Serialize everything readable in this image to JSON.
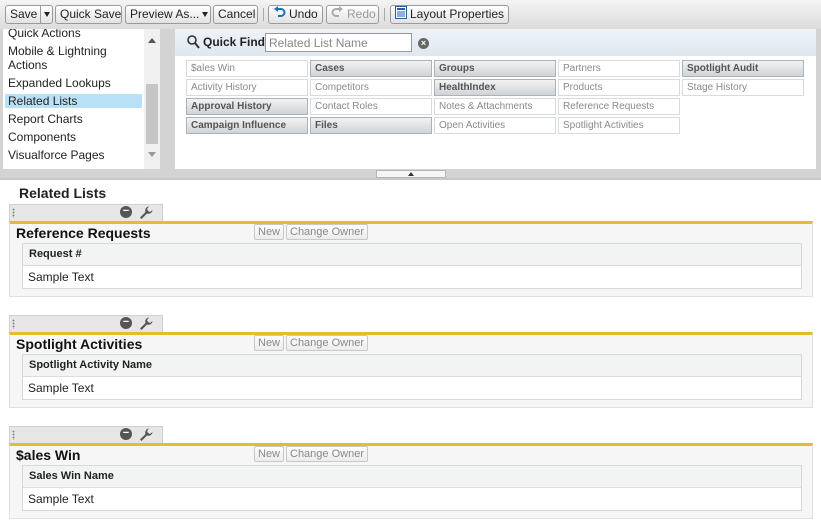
{
  "toolbar": {
    "save": "Save",
    "quick_save": "Quick Save",
    "preview_as": "Preview As...",
    "cancel": "Cancel",
    "undo": "Undo",
    "redo": "Redo",
    "layout_properties": "Layout Properties"
  },
  "palette": {
    "categories": [
      "Quick Actions",
      "Mobile & Lightning",
      "Actions",
      "Expanded Lookups",
      "Related Lists",
      "Report Charts",
      "Components",
      "Visualforce Pages"
    ],
    "selected_category": "Related Lists",
    "quick_find_label": "Quick Find",
    "quick_find_placeholder": "Related List Name",
    "fields": [
      [
        "$ales Win",
        "Cases",
        "Groups",
        "Partners",
        "Spotlight Audit"
      ],
      [
        "Activity History",
        "Competitors",
        "HealthIndex",
        "Products",
        "Stage History"
      ],
      [
        "Approval History",
        "Contact Roles",
        "Notes & Attachments",
        "Reference Requests"
      ],
      [
        "Campaign Influence",
        "Files",
        "Open Activities",
        "Spotlight Activities"
      ]
    ]
  },
  "layout": {
    "section_title": "Related Lists",
    "related_lists": [
      {
        "title": "Reference Requests",
        "new": "New",
        "change_owner": "Change Owner",
        "column": "Request #",
        "sample": "Sample Text"
      },
      {
        "title": "Spotlight Activities",
        "new": "New",
        "change_owner": "Change Owner",
        "column": "Spotlight Activity Name",
        "sample": "Sample Text"
      },
      {
        "title": "$ales Win",
        "new": "New",
        "change_owner": "Change Owner",
        "column": "Sales Win Name",
        "sample": "Sample Text"
      }
    ]
  },
  "colors": {
    "accent_border": "#e1bd33",
    "selected_category": "#b8e0f6",
    "undo_icon": "#1f6fbf"
  }
}
